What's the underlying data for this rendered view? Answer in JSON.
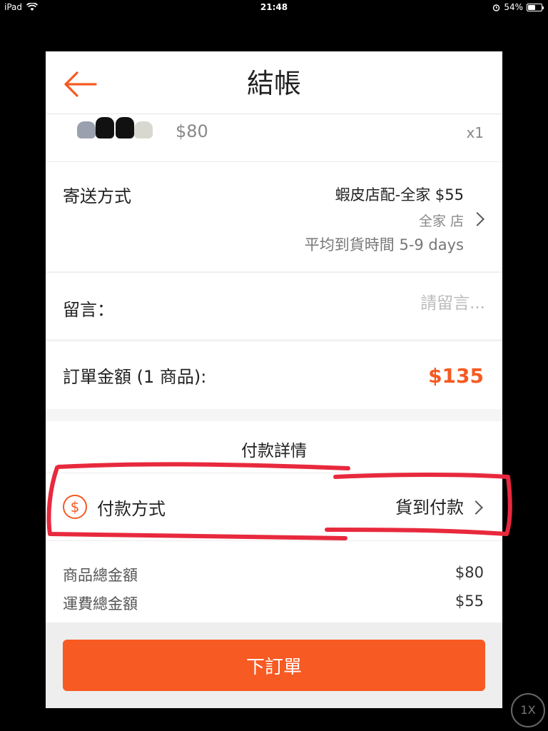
{
  "status_bar": {
    "device": "iPad",
    "time": "21:48",
    "battery_percent": "54%",
    "battery_level": 0.54
  },
  "header": {
    "title": "結帳"
  },
  "product": {
    "price": "$80",
    "quantity": "x1"
  },
  "shipping": {
    "label": "寄送方式",
    "method": "蝦皮店配-全家 $55",
    "store": "全家              店",
    "delivery_time": "平均到貨時間 5-9 days"
  },
  "message": {
    "label": "留言：",
    "placeholder": "請留言..."
  },
  "order_total": {
    "label": "訂單金額 (1 商品):",
    "value": "$135"
  },
  "payment": {
    "section_title": "付款詳情",
    "method_label": "付款方式",
    "method_value": "貨到付款",
    "coin_symbol": "$"
  },
  "summary": {
    "items_total_label": "商品總金額",
    "items_total_value": "$80",
    "shipping_total_label": "運費總金額",
    "shipping_total_value": "$55"
  },
  "place_order": {
    "label": "下訂單"
  },
  "zoom_badge": "1X",
  "colors": {
    "accent": "#f55a22",
    "annotation": "#e8293d"
  }
}
